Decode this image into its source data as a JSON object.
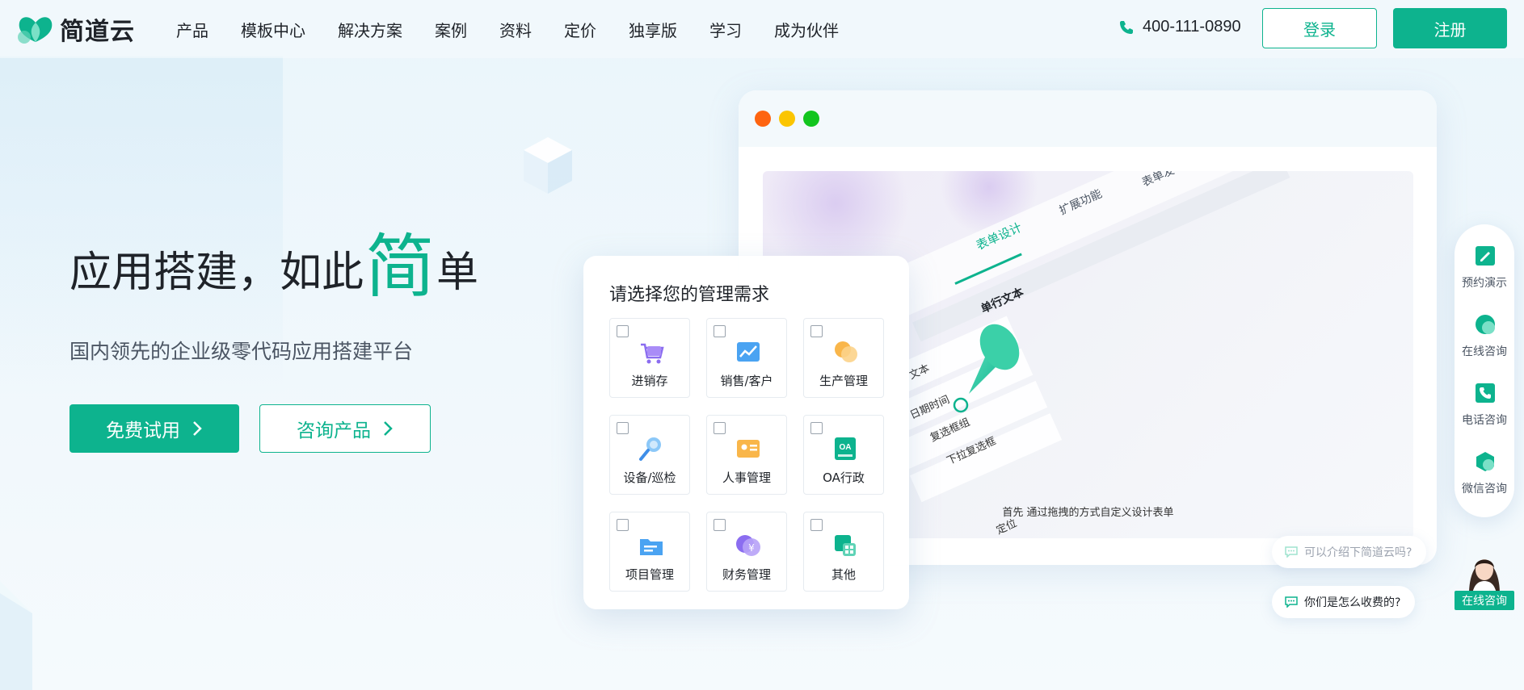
{
  "brand": {
    "name": "简道云",
    "accent": "#0db38e"
  },
  "nav": {
    "items": [
      "产品",
      "模板中心",
      "解决方案",
      "案例",
      "资料",
      "定价",
      "独享版",
      "学习",
      "成为伙伴"
    ]
  },
  "header": {
    "phone": "400-111-0890",
    "login_label": "登录",
    "register_label": "注册"
  },
  "hero": {
    "title_pre": "应用搭建，如此",
    "title_accent": "简",
    "title_post": "单",
    "subtitle": "国内领先的企业级零代码应用搭建平台",
    "try_label": "免费试用",
    "consult_label": "咨询产品"
  },
  "browser": {
    "dots": [
      "#fe6410",
      "#fbc500",
      "#12c51e"
    ],
    "screen": {
      "tabs": [
        "表单设计",
        "扩展功能",
        "表单发"
      ],
      "field_title": "单行文本",
      "fields": [
        "文本",
        "日期时间",
        "复选框组",
        "下拉复选框"
      ],
      "bottom_field": "定位",
      "caption": "首先  通过拖拽的方式自定义设计表单"
    }
  },
  "selector": {
    "title": "请选择您的管理需求",
    "options": [
      {
        "label": "进销存",
        "icon": "cart-icon"
      },
      {
        "label": "销售/客户",
        "icon": "chart-icon"
      },
      {
        "label": "生产管理",
        "icon": "production-icon"
      },
      {
        "label": "设备/巡检",
        "icon": "inspection-icon"
      },
      {
        "label": "人事管理",
        "icon": "hr-icon"
      },
      {
        "label": "OA行政",
        "icon": "oa-icon"
      },
      {
        "label": "项目管理",
        "icon": "project-icon"
      },
      {
        "label": "财务管理",
        "icon": "finance-icon"
      },
      {
        "label": "其他",
        "icon": "other-icon"
      }
    ]
  },
  "sidebar": {
    "items": [
      {
        "label": "预约演示",
        "icon": "demo-icon"
      },
      {
        "label": "在线咨询",
        "icon": "online-chat-icon"
      },
      {
        "label": "电话咨询",
        "icon": "phone-consult-icon"
      },
      {
        "label": "微信咨询",
        "icon": "wechat-icon"
      }
    ]
  },
  "chat": {
    "suggestions": [
      "可以介绍下简道云吗?",
      "你们是怎么收费的?"
    ],
    "agent_label": "在线咨询"
  }
}
